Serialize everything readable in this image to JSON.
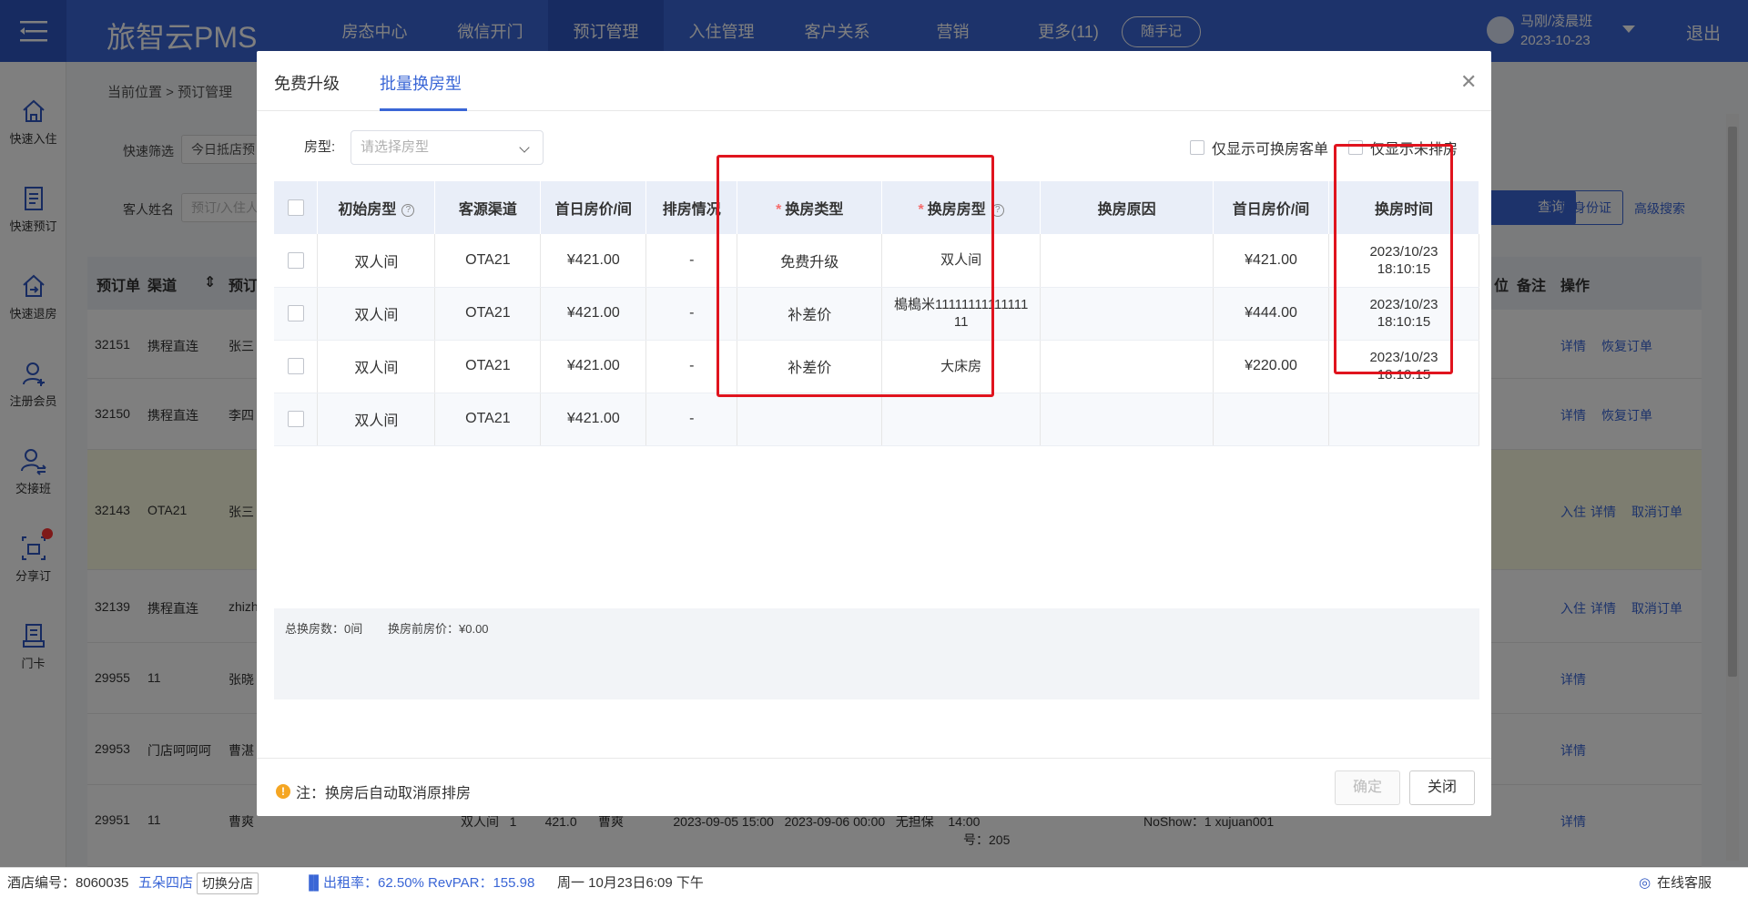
{
  "app": {
    "brand": "旅智云PMS",
    "nav": [
      "房态中心",
      "微信开门",
      "预订管理",
      "入住管理",
      "客户关系",
      "营销",
      "更多(11)"
    ],
    "nav_active": "预订管理",
    "pill": "随手记",
    "user": "马刚/凌晨班",
    "date": "2023-10-23",
    "logout": "退出"
  },
  "sidebar": [
    {
      "label": "快速入住",
      "icon": "home-icon"
    },
    {
      "label": "快速预订",
      "icon": "notebook-icon"
    },
    {
      "label": "快速退房",
      "icon": "exit-home-icon"
    },
    {
      "label": "注册会员",
      "icon": "add-user-icon"
    },
    {
      "label": "交接班",
      "icon": "handover-icon"
    },
    {
      "label": "分享订",
      "icon": "share-icon"
    },
    {
      "label": "门卡",
      "icon": "card-icon"
    }
  ],
  "background": {
    "breadcrumb": "当前位置 > 预订管理",
    "quick_filter_label": "快速筛选",
    "quick_filter_value": "今日抵店预",
    "guest_label": "客人姓名",
    "guest_placeholder": "预订/入住人",
    "query_button": "查询",
    "id_button": "读身份证",
    "advanced": "高级搜索",
    "headers": [
      "预订单",
      "渠道",
      "预订",
      "位",
      "备注",
      "操作"
    ],
    "rows": [
      {
        "id": "32151",
        "channel": "携程直连",
        "name": "张三",
        "actions": [
          "详情",
          "恢复订单"
        ]
      },
      {
        "id": "32150",
        "channel": "携程直连",
        "name": "李四",
        "actions": [
          "详情",
          "恢复订单"
        ]
      },
      {
        "id": "32143",
        "channel": "OTA21",
        "name": "张三",
        "actions": [
          "入住",
          "详情",
          "取消订单"
        ]
      },
      {
        "id": "32139",
        "channel": "携程直连",
        "name": "zhizh",
        "actions": [
          "入住",
          "详情",
          "取消订单"
        ]
      },
      {
        "id": "29955",
        "channel": "11",
        "name": "张晓",
        "actions": [
          "详情"
        ]
      },
      {
        "id": "29953",
        "channel": "门店呵呵呵",
        "name": "曹湛",
        "actions": [
          "详情"
        ]
      },
      {
        "id": "29951",
        "channel": "11",
        "name": "曹爽",
        "actions": [
          "详情"
        ],
        "extra": "双人间   1        421.0      曹爽              2023-09-05 15:00   2023-09-06 00:00   无担保    14:00",
        "extra2": "NoShow：1   xujuan001",
        "extra3": "号：205"
      }
    ]
  },
  "modal": {
    "tabs": [
      "免费升级",
      "批量换房型"
    ],
    "active_tab": "批量换房型",
    "room_type_label": "房型:",
    "room_type_placeholder": "请选择房型",
    "filter1": "仅显示可换房客单",
    "filter2": "仅显示未排房",
    "columns": [
      "初始房型",
      "客源渠道",
      "首日房价/间",
      "排房情况",
      "换房类型",
      "换房房型",
      "换房原因",
      "首日房价/间",
      "换房时间"
    ],
    "rows": [
      {
        "init": "双人间",
        "channel": "OTA21",
        "price": "¥421.00",
        "assign": "-",
        "type": "免费升级",
        "new_type": "双人间",
        "reason": "",
        "new_price": "¥421.00",
        "time": "2023/10/23\n18:10:15"
      },
      {
        "init": "双人间",
        "channel": "OTA21",
        "price": "¥421.00",
        "assign": "-",
        "type": "补差价",
        "new_type": "槝槝米11111111111111\n11",
        "reason": "",
        "new_price": "¥444.00",
        "time": "2023/10/23\n18:10:15"
      },
      {
        "init": "双人间",
        "channel": "OTA21",
        "price": "¥421.00",
        "assign": "-",
        "type": "补差价",
        "new_type": "大床房",
        "reason": "",
        "new_price": "¥220.00",
        "time": "2023/10/23\n18:10:15"
      },
      {
        "init": "双人间",
        "channel": "OTA21",
        "price": "¥421.00",
        "assign": "-",
        "type": "",
        "new_type": "",
        "reason": "",
        "new_price": "",
        "time": ""
      }
    ],
    "summary_total": "总换房数：0间",
    "summary_price": "换房前房价：¥0.00",
    "note": "注：换房后自动取消原排房",
    "confirm": "确定",
    "close": "关闭"
  },
  "statusbar": {
    "hotel_label": "酒店编号：8060035",
    "hotel_name": "五朵四店",
    "switch": "切换分店",
    "occupancy": "出租率：62.50% RevPAR：155.98",
    "datetime": "周一 10月23日6:09 下午",
    "support": "在线客服"
  },
  "colors": {
    "primary": "#3a66d6",
    "highlight_box": "#e0141e"
  }
}
